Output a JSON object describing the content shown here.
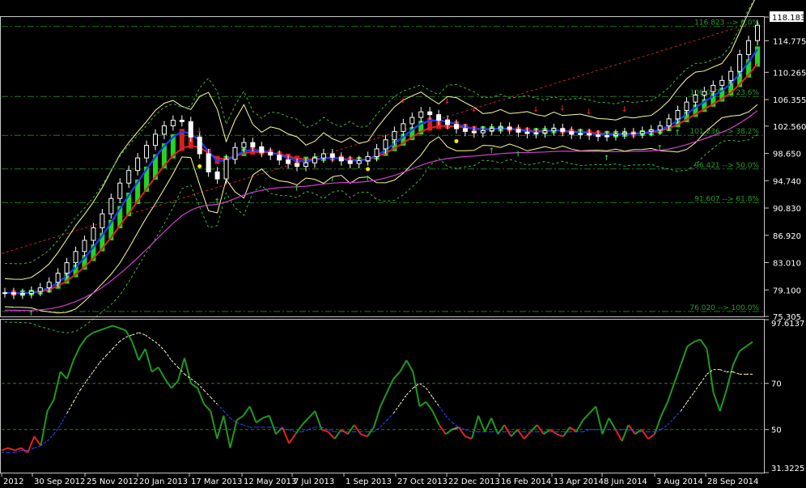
{
  "window": {
    "background": "#000000",
    "frame_color": "#c8c8c8"
  },
  "chart_data": [
    {
      "panel": "price",
      "type": "candlestick",
      "ylim": [
        75.305,
        118.183
      ],
      "yticks": [
        "118.183",
        "114.775",
        "110.265",
        "106.355",
        "102.560",
        "98.650",
        "94.740",
        "90.830",
        "86.920",
        "83.010",
        "79.100",
        "75.305"
      ],
      "fib_levels": [
        {
          "label": "116.823 --> 0.0%",
          "value": 116.823
        },
        {
          "label": "106.047 --> 23.6%",
          "value": 106.8
        },
        {
          "label": "101.236 --> 38.2%",
          "value": 101.236
        },
        {
          "label": "96.421 --> 50.0%",
          "value": 96.421
        },
        {
          "label": "91.607 --> 61.8%",
          "value": 91.607
        },
        {
          "label": "76.020 --> 100.0%",
          "value": 76.02
        }
      ],
      "close_series": [
        78.7,
        78.5,
        78.6,
        78.9,
        79.4,
        80.2,
        81.5,
        83.0,
        84.6,
        86.2,
        88.0,
        90.0,
        92.2,
        94.4,
        96.2,
        98.0,
        99.8,
        101.4,
        102.6,
        103.4,
        103.2,
        101.0,
        98.6,
        96.0,
        95.0,
        97.8,
        99.5,
        100.2,
        99.6,
        98.8,
        98.4,
        97.7,
        97.2,
        96.8,
        97.3,
        98.0,
        98.6,
        98.1,
        97.6,
        97.2,
        97.6,
        98.2,
        99.3,
        100.6,
        101.8,
        102.9,
        103.8,
        104.6,
        104.2,
        103.4,
        102.8,
        102.2,
        101.8,
        101.6,
        101.9,
        102.2,
        102.4,
        102.1,
        101.7,
        101.5,
        101.6,
        101.9,
        102.2,
        101.8,
        101.4,
        101.5,
        101.3,
        101.1,
        101.2,
        101.4,
        101.6,
        101.5,
        101.8,
        102.0,
        102.6,
        103.6,
        104.8,
        106.0,
        107.0,
        107.5,
        108.4,
        109.1,
        110.4,
        112.8,
        114.8,
        117.0
      ],
      "ma_fast": {
        "color": "#1a3cff"
      },
      "ma_slow": {
        "color": "#e62020"
      },
      "bollinger": {
        "color": "#ffffa0"
      },
      "magenta_ma": {
        "color": "#d040d0"
      },
      "trendline": {
        "color": "#cc2222"
      }
    },
    {
      "panel": "oscillator",
      "type": "line",
      "ylim": [
        31.3225,
        97.6137
      ],
      "yticks": [
        "97.6137",
        "70",
        "50",
        "31.3225"
      ],
      "levels": [
        70,
        50
      ],
      "x_tick_labels": [
        "2012",
        "30 Sep 2012",
        "25 Nov 2012",
        "20 Jan 2013",
        "17 Mar 2013",
        "12 May 2013",
        "7 Jul 2013",
        "1 Sep 2013",
        "27 Oct 2013",
        "22 Dec 2013",
        "16 Feb 2014",
        "13 Apr 2014",
        "8 Jun 2014",
        "3 Aug 2014",
        "28 Sep 2014"
      ],
      "main_series": [
        41,
        42,
        41,
        42,
        40,
        47,
        43,
        58,
        63,
        75,
        72,
        80,
        86,
        90,
        92,
        93,
        94,
        95,
        94,
        93,
        88,
        80,
        85,
        75,
        77,
        72,
        68,
        71,
        81,
        70,
        68,
        61,
        58,
        46,
        56,
        42,
        54,
        56,
        60,
        53,
        55,
        56,
        48,
        51,
        44,
        48,
        52,
        55,
        58,
        50,
        49,
        46,
        50,
        48,
        52,
        48,
        47,
        51,
        60,
        66,
        72,
        75,
        80,
        75,
        60,
        62,
        58,
        52,
        48,
        50,
        51,
        47,
        46,
        56,
        49,
        55,
        48,
        52,
        47,
        50,
        46,
        49,
        52,
        48,
        50,
        48,
        47,
        51,
        49,
        54,
        57,
        60,
        48,
        55,
        50,
        45,
        52,
        48,
        50,
        46,
        48,
        56,
        62,
        70,
        78,
        86,
        88,
        89,
        85,
        66,
        58,
        67,
        78,
        84,
        86,
        88
      ],
      "signal_series": [
        40,
        40,
        40,
        41,
        41,
        42,
        43,
        45,
        48,
        52,
        57,
        62,
        67,
        71,
        75,
        79,
        82,
        85,
        88,
        90,
        91,
        92,
        91,
        89,
        87,
        84,
        80,
        77,
        74,
        72,
        70,
        67,
        64,
        61,
        58,
        55,
        53,
        52,
        51,
        51,
        51,
        51,
        51,
        50,
        50,
        49,
        49,
        50,
        51,
        51,
        50,
        49,
        49,
        49,
        49,
        49,
        49,
        49,
        51,
        54,
        57,
        61,
        65,
        68,
        70,
        68,
        64,
        60,
        56,
        53,
        51,
        50,
        49,
        49,
        49,
        49,
        49,
        49,
        49,
        49,
        49,
        49,
        49,
        49,
        49,
        49,
        49,
        49,
        49,
        49,
        50,
        50,
        50,
        50,
        50,
        50,
        50,
        49,
        49,
        49,
        49,
        50,
        52,
        55,
        58,
        62,
        66,
        70,
        74,
        76,
        76,
        75,
        75,
        74,
        74,
        74
      ]
    }
  ]
}
